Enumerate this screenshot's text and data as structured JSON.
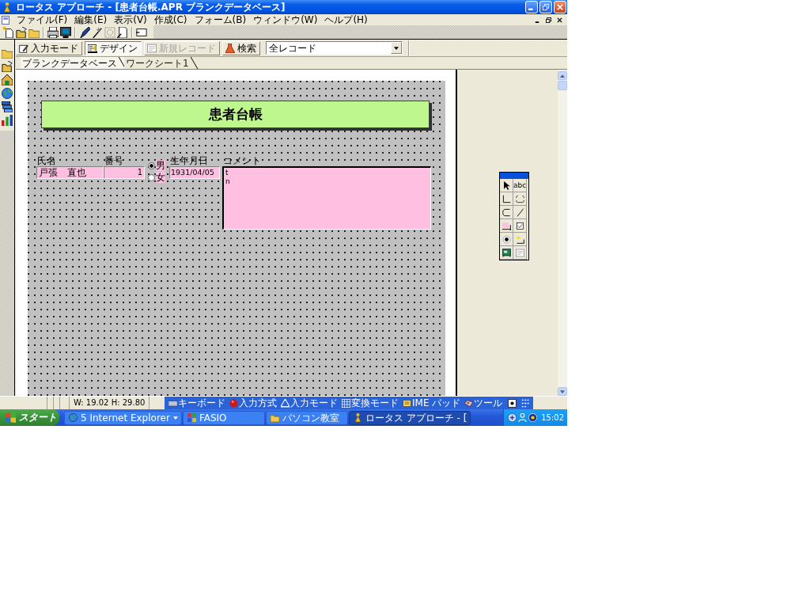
{
  "window": {
    "title": "ロータス アプローチ - [患者台帳.APR ブランクデータベース]"
  },
  "menu": [
    "ファイル(F)",
    "編集(E)",
    "表示(V)",
    "作成(C)",
    "フォーム(B)",
    "ウィンドウ(W)",
    "ヘルプ(H)"
  ],
  "mode_toolbar": {
    "buttons": [
      {
        "kind": "browse",
        "label": "入力モード",
        "pressed": false,
        "disabled": false
      },
      {
        "kind": "design",
        "label": "デザイン",
        "pressed": true,
        "disabled": false
      },
      {
        "kind": "new",
        "label": "新規レコード",
        "pressed": false,
        "disabled": true
      },
      {
        "kind": "find",
        "label": "検索",
        "pressed": false,
        "disabled": false
      }
    ],
    "view_select": {
      "value": "全レコード"
    }
  },
  "tabs": [
    {
      "label": "ブランクデータベース",
      "selected": true
    },
    {
      "label": "ワークシート1",
      "selected": false
    }
  ],
  "form": {
    "title": "患者台帳",
    "fields": [
      {
        "kind": "text",
        "label": "氏名",
        "value": "戸張　直也"
      },
      {
        "kind": "number",
        "label": "番号",
        "value": "1"
      },
      {
        "kind": "radio",
        "options": [
          {
            "label": "男",
            "selected": true
          },
          {
            "label": "女",
            "selected": false
          }
        ]
      },
      {
        "kind": "date",
        "label": "生年月日",
        "value": "1931/04/05"
      },
      {
        "kind": "memo",
        "label": "コメント",
        "lines": [
          "t",
          "n"
        ]
      }
    ]
  },
  "toolbox": {
    "text_tool": "abc"
  },
  "status_bar": {
    "dimensions": "W: 19.02 H: 29.80"
  },
  "language_bar": {
    "items": [
      {
        "kind": "keyboard",
        "label": "キーボード"
      },
      {
        "kind": "input_method",
        "label": "入力方式"
      },
      {
        "kind": "input_mode",
        "label": "入力モード"
      },
      {
        "kind": "conversion",
        "label": "変換モード"
      },
      {
        "kind": "pad",
        "label": "IME パッド"
      },
      {
        "kind": "tool",
        "label": "ツール"
      }
    ]
  },
  "taskbar": {
    "start": "スタート",
    "tasks": [
      {
        "kind": "browser",
        "label": "5 Internet Explorer",
        "grouped": true,
        "selected": false
      },
      {
        "kind": "app",
        "label": "FASIO",
        "grouped": false,
        "selected": false
      },
      {
        "kind": "folder",
        "label": "パソコン教室",
        "grouped": false,
        "selected": false
      },
      {
        "kind": "approach",
        "label": "ロータス アプローチ - [",
        "grouped": false,
        "selected": true
      }
    ],
    "clock": "15:02"
  }
}
